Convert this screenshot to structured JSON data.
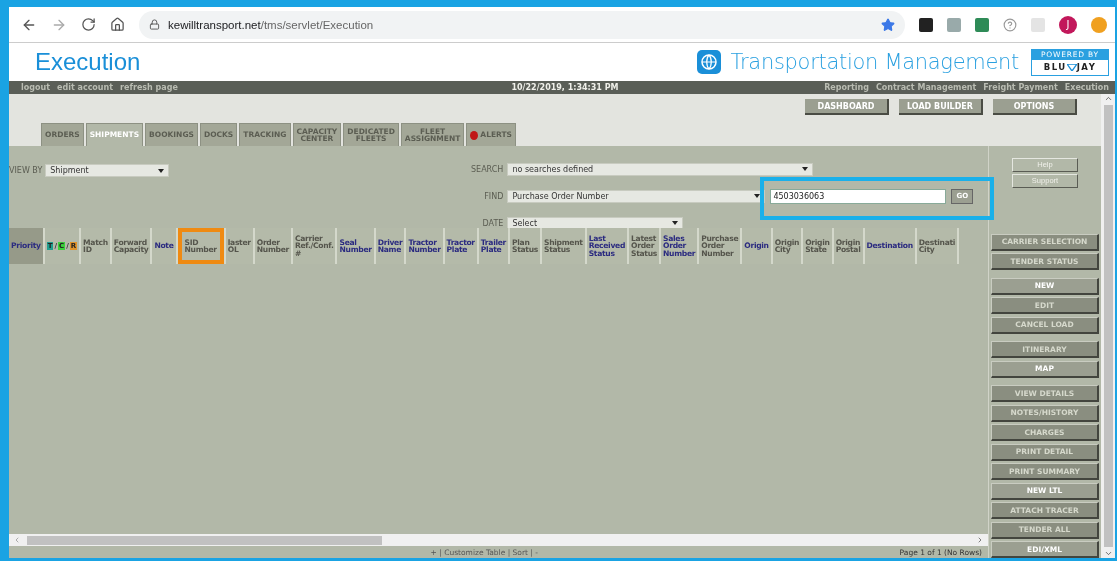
{
  "browser": {
    "url_host": "kewilltransport.net",
    "url_path": "/tms/servlet/Execution",
    "profile_initial": "J"
  },
  "header": {
    "title": "Execution",
    "product": "Transportation Management",
    "powered_by": "POWERED BY",
    "brand_left": "BLU",
    "brand_right": "JAY"
  },
  "topbar": {
    "left_links": [
      "logout",
      "edit account",
      "refresh page"
    ],
    "datetime": "10/22/2019, 1:34:31 PM",
    "right_links": [
      "Reporting",
      "Contract Management",
      "Freight Payment",
      "Execution"
    ]
  },
  "top_buttons": [
    "DASHBOARD",
    "LOAD BUILDER",
    "OPTIONS"
  ],
  "tabs": [
    {
      "lines": [
        "ORDERS"
      ],
      "selected": false,
      "alert": false
    },
    {
      "lines": [
        "SHIPMENTS"
      ],
      "selected": true,
      "alert": false
    },
    {
      "lines": [
        "BOOKINGS"
      ],
      "selected": false,
      "alert": false
    },
    {
      "lines": [
        "DOCKS"
      ],
      "selected": false,
      "alert": false
    },
    {
      "lines": [
        "TRACKING"
      ],
      "selected": false,
      "alert": false
    },
    {
      "lines": [
        "CAPACITY",
        "CENTER"
      ],
      "selected": false,
      "alert": false
    },
    {
      "lines": [
        "DEDICATED",
        "FLEETS"
      ],
      "selected": false,
      "alert": false
    },
    {
      "lines": [
        "FLEET",
        "ASSIGNMENT"
      ],
      "selected": false,
      "alert": false
    },
    {
      "lines": [
        "ALERTS"
      ],
      "selected": false,
      "alert": true
    }
  ],
  "search": {
    "view_by_label": "VIEW BY",
    "view_by": "Shipment",
    "search_label": "SEARCH",
    "search_value": "no searches defined",
    "find_label": "FIND",
    "find_value": "Purchase Order Number",
    "find_input": "4503036063",
    "find_highlighted": true,
    "go": "GO",
    "date_label": "DATE",
    "date_value": "Select"
  },
  "help_buttons": [
    "Help",
    "Support"
  ],
  "columns": [
    {
      "kind": "text",
      "lines": [
        "Priority"
      ],
      "color": "#2b2b80",
      "selected": true,
      "highlighted": false
    },
    {
      "kind": "legend",
      "letters": [
        {
          "text": "T",
          "color": "#1f9e8f"
        },
        {
          "text": "C",
          "color": "#3ccf3c"
        },
        {
          "text": "R",
          "color": "#e0932a"
        }
      ],
      "separator": "/",
      "selected": false,
      "highlighted": false
    },
    {
      "kind": "text",
      "lines": [
        "Match",
        "ID"
      ],
      "color": "#55554c",
      "selected": false,
      "highlighted": false
    },
    {
      "kind": "text",
      "lines": [
        "Forward",
        "Capacity"
      ],
      "color": "#55554c",
      "selected": false,
      "highlighted": false
    },
    {
      "kind": "text",
      "lines": [
        "Note"
      ],
      "color": "#2b2b80",
      "selected": false,
      "highlighted": false
    },
    {
      "kind": "text",
      "lines": [
        "SID",
        "Number"
      ],
      "color": "#55554c",
      "selected": false,
      "highlighted": true
    },
    {
      "kind": "text",
      "lines": [
        "laster",
        "OL"
      ],
      "color": "#55554c",
      "selected": false,
      "highlighted": false
    },
    {
      "kind": "text",
      "lines": [
        "Order",
        "Number"
      ],
      "color": "#55554c",
      "selected": false,
      "highlighted": false
    },
    {
      "kind": "text",
      "lines": [
        "Carrier",
        "Ref./Conf.",
        "#"
      ],
      "color": "#55554c",
      "selected": false,
      "highlighted": false
    },
    {
      "kind": "text",
      "lines": [
        "Seal",
        "Number"
      ],
      "color": "#2b2b80",
      "selected": false,
      "highlighted": false
    },
    {
      "kind": "text",
      "lines": [
        "Driver",
        "Name"
      ],
      "color": "#2b2b80",
      "selected": false,
      "highlighted": false
    },
    {
      "kind": "text",
      "lines": [
        "Tractor",
        "Number"
      ],
      "color": "#2b2b80",
      "selected": false,
      "highlighted": false
    },
    {
      "kind": "text",
      "lines": [
        "Tractor",
        "Plate"
      ],
      "color": "#2b2b80",
      "selected": false,
      "highlighted": false
    },
    {
      "kind": "text",
      "lines": [
        "Trailer",
        "Plate"
      ],
      "color": "#2b2b80",
      "selected": false,
      "highlighted": false
    },
    {
      "kind": "text",
      "lines": [
        "Plan",
        "Status"
      ],
      "color": "#55554c",
      "selected": false,
      "highlighted": false
    },
    {
      "kind": "text",
      "lines": [
        "Shipment",
        "Status"
      ],
      "color": "#55554c",
      "selected": false,
      "highlighted": false
    },
    {
      "kind": "text",
      "lines": [
        "Last",
        "Received",
        "Status"
      ],
      "color": "#2b2b80",
      "selected": false,
      "highlighted": false
    },
    {
      "kind": "text",
      "lines": [
        "Latest",
        "Order",
        "Status"
      ],
      "color": "#55554c",
      "selected": false,
      "highlighted": false
    },
    {
      "kind": "text",
      "lines": [
        "Sales",
        "Order",
        "Number"
      ],
      "color": "#2b2b80",
      "selected": false,
      "highlighted": false
    },
    {
      "kind": "text",
      "lines": [
        "Purchase",
        "Order",
        "Number"
      ],
      "color": "#55554c",
      "selected": false,
      "highlighted": false
    },
    {
      "kind": "text",
      "lines": [
        "Origin"
      ],
      "color": "#2b2b80",
      "selected": false,
      "highlighted": false
    },
    {
      "kind": "text",
      "lines": [
        "Origin",
        "City"
      ],
      "color": "#55554c",
      "selected": false,
      "highlighted": false
    },
    {
      "kind": "text",
      "lines": [
        "Origin",
        "State"
      ],
      "color": "#55554c",
      "selected": false,
      "highlighted": false
    },
    {
      "kind": "text",
      "lines": [
        "Origin",
        "Postal"
      ],
      "color": "#55554c",
      "selected": false,
      "highlighted": false
    },
    {
      "kind": "text",
      "lines": [
        "Destination"
      ],
      "color": "#2b2b80",
      "selected": false,
      "highlighted": false
    },
    {
      "kind": "text",
      "lines": [
        "Destinati",
        "City"
      ],
      "color": "#55554c",
      "selected": false,
      "highlighted": false
    }
  ],
  "side_buttons": [
    {
      "label": "CARRIER SELECTION",
      "disabled": true,
      "gap_before": false
    },
    {
      "label": "TENDER STATUS",
      "disabled": true,
      "gap_before": false
    },
    {
      "label": "NEW",
      "disabled": false,
      "gap_before": true
    },
    {
      "label": "EDIT",
      "disabled": true,
      "gap_before": false
    },
    {
      "label": "CANCEL LOAD",
      "disabled": true,
      "gap_before": false
    },
    {
      "label": "ITINERARY",
      "disabled": true,
      "gap_before": true
    },
    {
      "label": "MAP",
      "disabled": false,
      "gap_before": false
    },
    {
      "label": "VIEW DETAILS",
      "disabled": true,
      "gap_before": true
    },
    {
      "label": "NOTES/HISTORY",
      "disabled": true,
      "gap_before": false
    },
    {
      "label": "CHARGES",
      "disabled": true,
      "gap_before": false
    },
    {
      "label": "PRINT DETAIL",
      "disabled": true,
      "gap_before": false
    },
    {
      "label": "PRINT SUMMARY",
      "disabled": true,
      "gap_before": false
    },
    {
      "label": "NEW LTL",
      "disabled": false,
      "gap_before": false
    },
    {
      "label": "ATTACH TRACER",
      "disabled": true,
      "gap_before": false
    },
    {
      "label": "TENDER ALL",
      "disabled": true,
      "gap_before": false
    },
    {
      "label": "EDI/XML",
      "disabled": false,
      "gap_before": false
    }
  ],
  "footer": {
    "table_links": "+ | Customize Table | Sort | -",
    "page_info": "Page 1 of 1 (No Rows)"
  }
}
